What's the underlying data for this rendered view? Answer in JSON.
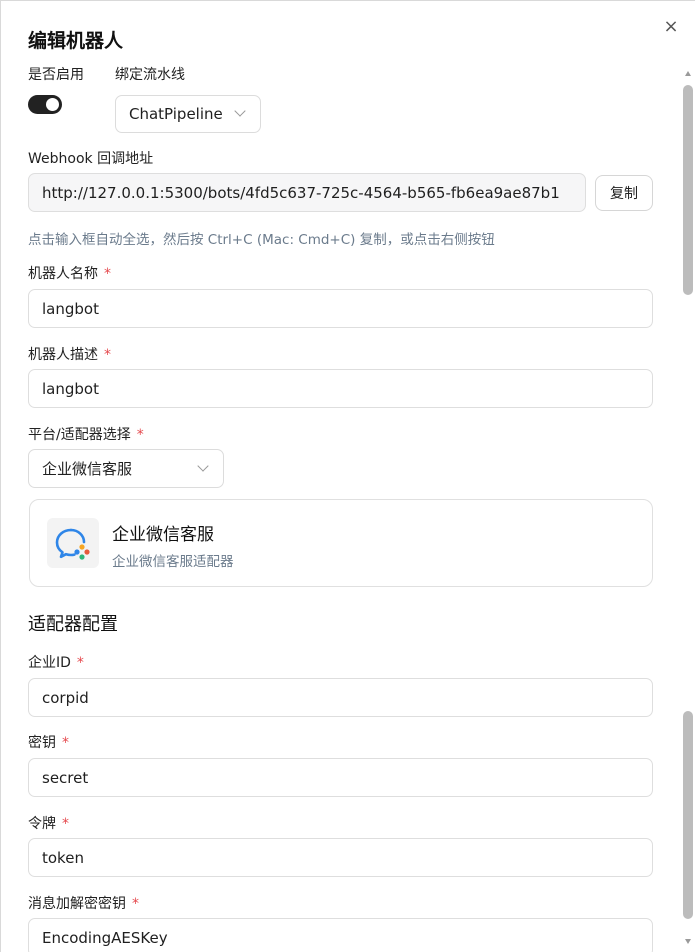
{
  "dialog": {
    "title": "编辑机器人",
    "close_icon": "×"
  },
  "enable": {
    "label": "是否启用",
    "on": true
  },
  "pipeline": {
    "label": "绑定流水线",
    "value": "ChatPipeline"
  },
  "webhook": {
    "label": "Webhook 回调地址",
    "value": "http://127.0.0.1:5300/bots/4fd5c637-725c-4564-b565-fb6ea9ae87b1",
    "copy_label": "复制",
    "hint": "点击输入框自动全选，然后按 Ctrl+C (Mac: Cmd+C) 复制，或点击右侧按钮"
  },
  "bot_name": {
    "label": "机器人名称",
    "required": "*",
    "value": "langbot"
  },
  "bot_desc": {
    "label": "机器人描述",
    "required": "*",
    "value": "langbot"
  },
  "platform": {
    "label": "平台/适配器选择",
    "required": "*",
    "value": "企业微信客服"
  },
  "adapter_card": {
    "title": "企业微信客服",
    "description": "企业微信客服适配器",
    "icon": "wecom-kf-icon"
  },
  "adapter_config": {
    "title": "适配器配置",
    "fields": [
      {
        "label": "企业ID",
        "required": "*",
        "value": "corpid"
      },
      {
        "label": "密钥",
        "required": "*",
        "value": "secret"
      },
      {
        "label": "令牌",
        "required": "*",
        "value": "token"
      },
      {
        "label": "消息加解密密钥",
        "required": "*",
        "value": "EncodingAESKey"
      }
    ]
  },
  "colors": {
    "required": "#e5484d",
    "toggle_on": "#222222",
    "hint": "#6b7b8c"
  }
}
